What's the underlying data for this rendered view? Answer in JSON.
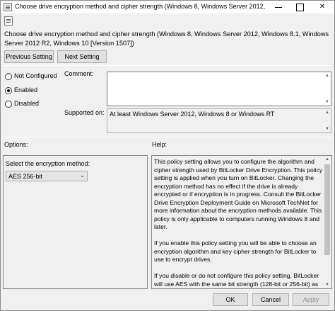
{
  "window": {
    "title": "Choose drive encryption method and cipher strength (Windows 8, Windows Server 2012, Windo...",
    "close_glyph": "✕"
  },
  "header": {
    "policy_title": "Choose drive encryption method and cipher strength (Windows 8, Windows Server 2012, Windows 8.1, Windows Server 2012 R2, Windows 10 [Version 1507])",
    "previous_label": "Previous Setting",
    "next_label": "Next Setting"
  },
  "state": {
    "options": [
      {
        "label": "Not Configured",
        "selected": false
      },
      {
        "label": "Enabled",
        "selected": true
      },
      {
        "label": "Disabled",
        "selected": false
      }
    ],
    "comment_label": "Comment:",
    "comment_value": "",
    "supported_label": "Supported on:",
    "supported_value": "At least Windows Server 2012, Windows 8 or Windows RT"
  },
  "options_panel": {
    "heading": "Options:",
    "select_label": "Select the encryption method:",
    "select_value": "AES 256-bit"
  },
  "help_panel": {
    "heading": "Help:",
    "paragraphs": [
      "This policy setting allows you to configure the algorithm and cipher strength used by BitLocker Drive Encryption. This policy setting is applied when you turn on BitLocker. Changing the encryption method has no effect if the drive is already encrypted or if encryption is in progress. Consult the BitLocker Drive Encryption Deployment Guide on Microsoft TechNet for more information about the encryption methods available. This policy is only applicable to computers running Windows 8 and later.",
      "If you enable this policy setting you will be able to choose an encryption algorithm and key cipher strength for BitLocker to use to encrypt drives.",
      "If you disable or do not configure this policy setting, BitLocker will use AES with the same bit strength (128-bit or 256-bit) as the \"Choose drive encryption method and cipher strength (Windows Vista, Windows Server 2008, Windows 7)\" policy setting, if it is"
    ]
  },
  "footer": {
    "ok_label": "OK",
    "cancel_label": "Cancel",
    "apply_label": "Apply"
  }
}
